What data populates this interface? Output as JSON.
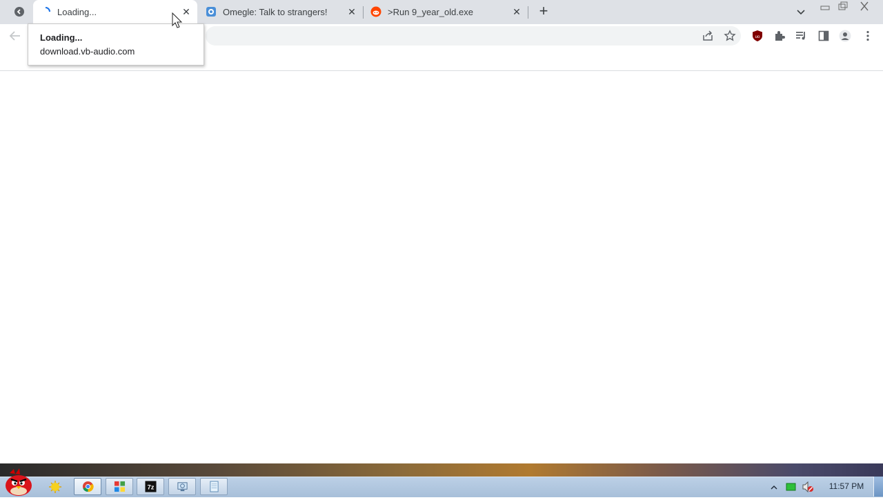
{
  "browser": {
    "tabs": [
      {
        "title": "Loading...",
        "active": true,
        "icon": "loading-spinner-icon"
      },
      {
        "title": "Omegle: Talk to strangers!",
        "active": false,
        "icon": "omegle-favicon-icon"
      },
      {
        "title": ">Run 9_year_old.exe",
        "active": false,
        "icon": "reddit-favicon-icon"
      }
    ],
    "close_glyph": "✕",
    "new_tab_glyph": "+",
    "tooltip": {
      "title": "Loading...",
      "url": "download.vb-audio.com"
    }
  },
  "taskbar": {
    "clock": "11:57 PM",
    "apps": [
      "angry-birds-start-icon",
      "file-explorer-icon",
      "chrome-icon",
      "paint-icon",
      "7zip-icon",
      "network-tool-icon",
      "notepad-icon"
    ]
  },
  "colors": {
    "accent": "#1a73e8",
    "ublock": "#800000",
    "reddit": "#ff4500"
  }
}
